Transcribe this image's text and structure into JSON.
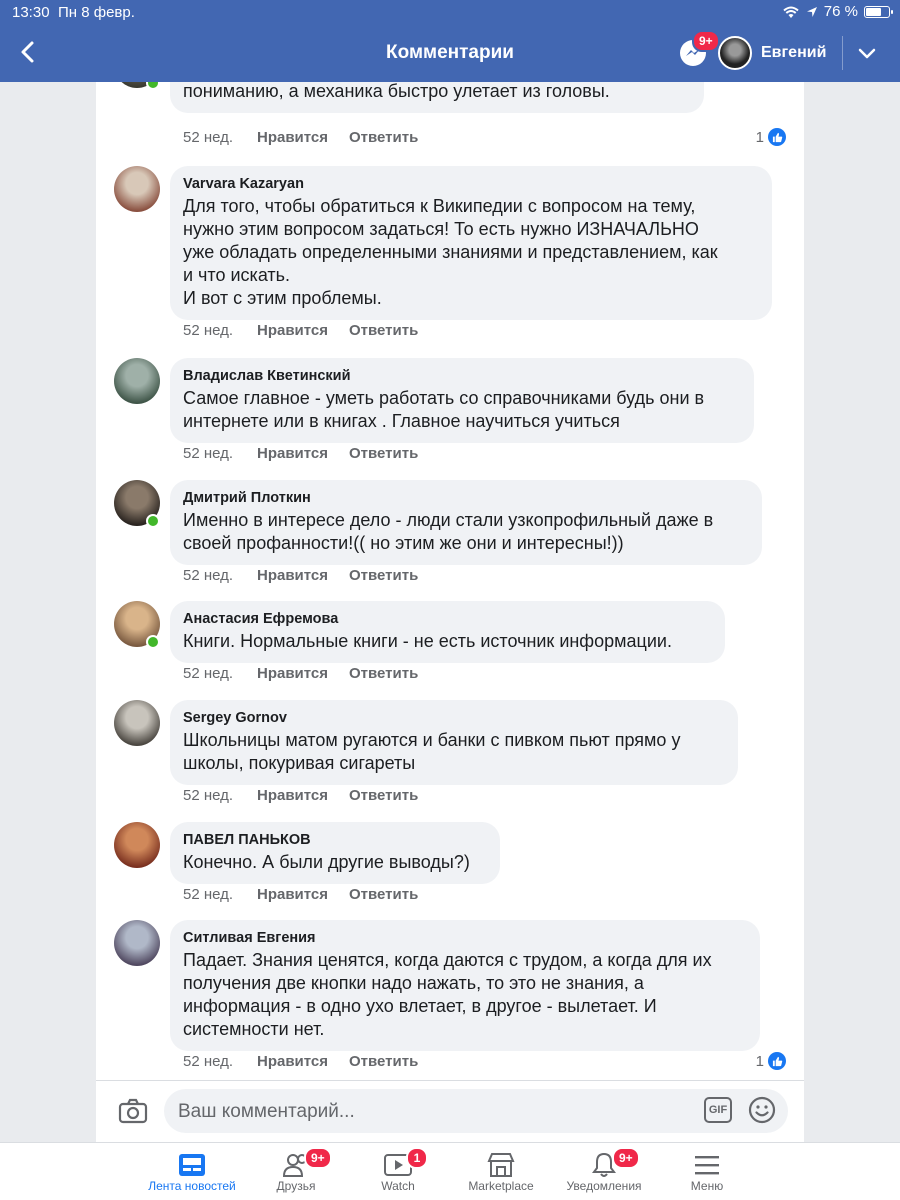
{
  "status_bar": {
    "time": "13:30",
    "date": "Пн 8 февр.",
    "battery": "76 %",
    "battery_level": 0.76
  },
  "header": {
    "title": "Комментарии",
    "messenger_badge": "9+",
    "user_name": "Евгений"
  },
  "comments": [
    {
      "name": "",
      "text": "Пропадает логика процесса познания, что способствует\nпониманию, а механика быстро улетает из головы.",
      "age": "52 нед.",
      "like_label": "Нравится",
      "reply_label": "Ответить",
      "reactions": "1",
      "avatar_colors": [
        "#6d6a5e",
        "#3a3a32"
      ],
      "online": true
    },
    {
      "name": "Varvara Kazaryan",
      "text": "Для того, чтобы обратиться к Википедии с вопросом на тему,\nнужно этим вопросом задаться! То есть нужно ИЗНАЧАЛЬНО\nуже обладать определенными знаниями и представлением, как\nи что искать.\nИ вот с этим проблемы.",
      "age": "52 нед.",
      "like_label": "Нравится",
      "reply_label": "Ответить",
      "reactions": "",
      "avatar_colors": [
        "#d8c8b8",
        "#8a5040"
      ],
      "online": false
    },
    {
      "name": "Владислав Кветинский",
      "text": "Самое главное - уметь работать со справочниками будь они в\nинтернете или в книгах . Главное научиться учиться",
      "age": "52 нед.",
      "like_label": "Нравится",
      "reply_label": "Ответить",
      "reactions": "",
      "avatar_colors": [
        "#9fb0a8",
        "#3f5548"
      ],
      "online": false
    },
    {
      "name": "Дмитрий Плоткин",
      "text": "Именно в интересе дело - люди стали узкопрофильный даже в\nсвоей профанности!(( но этим же они и интересны!))",
      "age": "52 нед.",
      "like_label": "Нравится",
      "reply_label": "Ответить",
      "reactions": "",
      "avatar_colors": [
        "#8a7a6a",
        "#2a2420"
      ],
      "online": true
    },
    {
      "name": "Анастасия Ефремова",
      "text": "Книги. Нормальные книги - не есть источник информации.",
      "age": "52 нед.",
      "like_label": "Нравится",
      "reply_label": "Ответить",
      "reactions": "",
      "avatar_colors": [
        "#d9b48a",
        "#7a5a40"
      ],
      "online": true
    },
    {
      "name": "Sergey Gornov",
      "text": "Школьницы матом ругаются и банки с  пивком пьют прямо у\nшколы, покуривая сигареты",
      "age": "52 нед.",
      "like_label": "Нравится",
      "reply_label": "Ответить",
      "reactions": "",
      "avatar_colors": [
        "#c8c4bc",
        "#4a4640"
      ],
      "online": false
    },
    {
      "name": "ПАВЕЛ ПАНЬКОВ",
      "text": "Конечно. А были другие выводы?)",
      "age": "52 нед.",
      "like_label": "Нравится",
      "reply_label": "Ответить",
      "reactions": "",
      "avatar_colors": [
        "#d0885a",
        "#7a3020"
      ],
      "online": false
    },
    {
      "name": "Ситливая Евгения",
      "text": "Падает. Знания ценятся, когда даются с трудом, а когда для их\nполучения две кнопки надо нажать, то это не знания, а\nинформация - в одно ухо влетает, в другое - вылетает. И\nсистемности нет.",
      "age": "52 нед.",
      "like_label": "Нравится",
      "reply_label": "Ответить",
      "reactions": "1",
      "avatar_colors": [
        "#b0b8c8",
        "#504860"
      ],
      "online": false
    }
  ],
  "composer": {
    "placeholder": "Ваш комментарий...",
    "gif_label": "GIF"
  },
  "tabs": [
    {
      "label": "Лента новостей",
      "icon": "news-feed-icon",
      "badge": "",
      "active": true
    },
    {
      "label": "Друзья",
      "icon": "friends-icon",
      "badge": "9+",
      "active": false
    },
    {
      "label": "Watch",
      "icon": "watch-icon",
      "badge": "1",
      "active": false
    },
    {
      "label": "Marketplace",
      "icon": "marketplace-icon",
      "badge": "",
      "active": false
    },
    {
      "label": "Уведомления",
      "icon": "bell-icon",
      "badge": "9+",
      "active": false
    },
    {
      "label": "Меню",
      "icon": "menu-icon",
      "badge": "",
      "active": false
    }
  ],
  "colors": {
    "brand": "#4267b2",
    "like_blue": "#1877f2",
    "online_green": "#42b72a",
    "badge_red": "#f02849"
  }
}
